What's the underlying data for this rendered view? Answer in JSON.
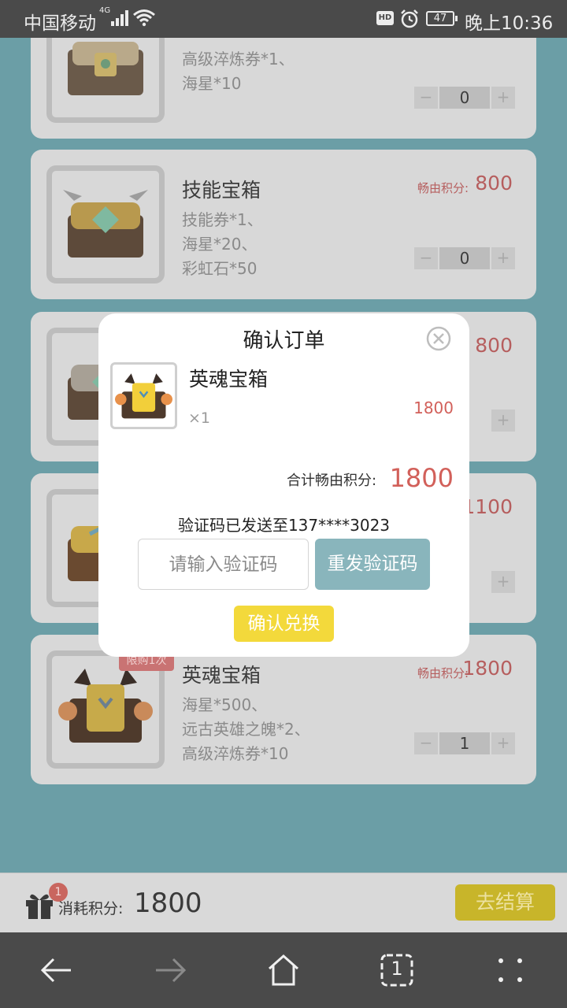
{
  "status_bar": {
    "carrier": "中国移动",
    "network": "4G",
    "hd": "HD",
    "battery": "47",
    "time": "晚上10:36"
  },
  "cards": [
    {
      "name": "",
      "price_label": "",
      "price": "",
      "desc_lines": [
        "高级淬炼券*1、",
        "海星*10"
      ],
      "qty": "0",
      "limit": ""
    },
    {
      "name": "技能宝箱",
      "price_label": "畅由积分:",
      "price": "800",
      "desc_lines": [
        "技能券*1、",
        "海星*20、",
        "彩虹石*50"
      ],
      "qty": "0",
      "limit": ""
    },
    {
      "name": "",
      "price_label": "",
      "price": "800",
      "desc_lines": [],
      "qty": "",
      "limit": ""
    },
    {
      "name": "",
      "price_label": "",
      "price": "1100",
      "desc_lines": [],
      "qty": "",
      "limit": ""
    },
    {
      "name": "英魂宝箱",
      "price_label": "畅由积分:",
      "price": "1800",
      "desc_lines": [
        "海星*500、",
        "远古英雄之魄*2、",
        "高级淬炼券*10"
      ],
      "qty": "1",
      "limit": "限购1次"
    }
  ],
  "modal": {
    "title": "确认订单",
    "product_name": "英魂宝箱",
    "product_qty": "×1",
    "product_price": "1800",
    "total_label": "合计畅由积分:",
    "total_value": "1800",
    "sent_text": "验证码已发送至137****3023",
    "code_placeholder": "请输入验证码",
    "resend_label": "重发验证码",
    "confirm_label": "确认兑换"
  },
  "bottom_bar": {
    "gift_badge": "1",
    "consume_label": "消耗积分:",
    "consume_value": "1800",
    "checkout_label": "去结算"
  },
  "nav_bar": {
    "tabs_count": "1"
  },
  "colors": {
    "overlay": "#6b9ea6",
    "accent_red": "#d2605a",
    "confirm_yellow": "#f3d93b",
    "resend_blue": "#89b5bc"
  }
}
